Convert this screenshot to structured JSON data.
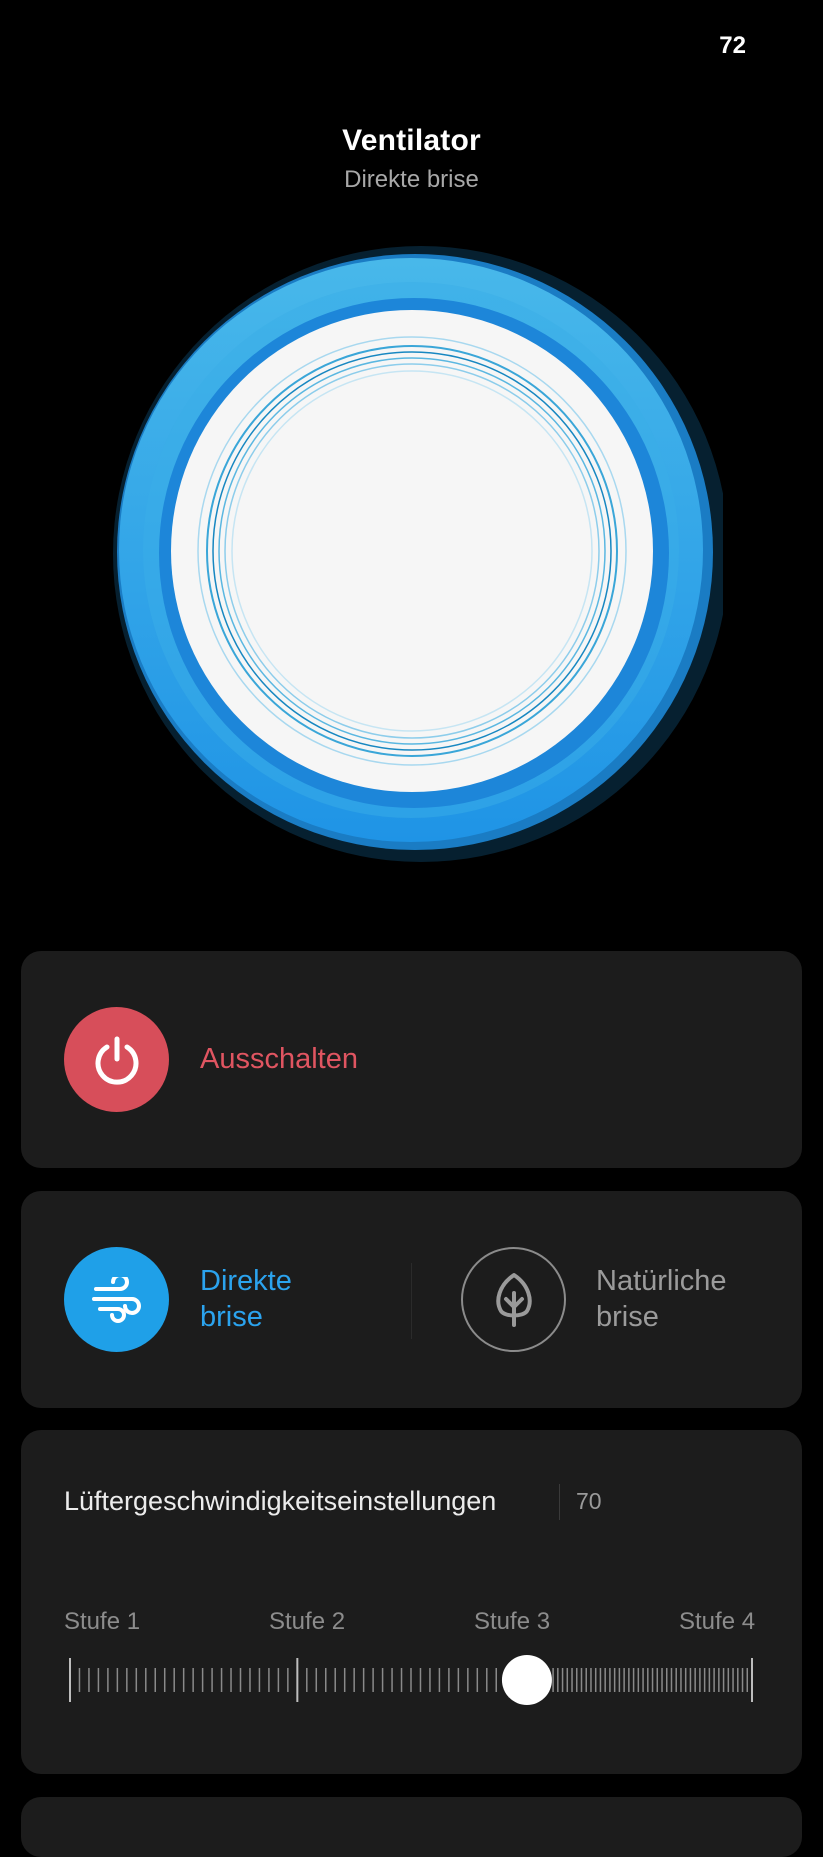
{
  "status_bar": {
    "number": "72"
  },
  "header": {
    "title": "Ventilator",
    "subtitle": "Direkte brise"
  },
  "colors": {
    "accent_blue": "#1fa0e8",
    "power_red": "#d74e5a",
    "card_bg": "#1c1c1c"
  },
  "power": {
    "label": "Ausschalten",
    "icon": "power-icon"
  },
  "modes": [
    {
      "label_line1": "Direkte",
      "label_line2": "brise",
      "icon": "wind-icon",
      "active": true
    },
    {
      "label_line1": "Natürliche",
      "label_line2": "brise",
      "icon": "leaf-icon",
      "active": false
    }
  ],
  "speed": {
    "title": "Lüftergeschwindigkeitseinstellungen",
    "value": "70",
    "steps": [
      "Stufe 1",
      "Stufe 2",
      "Stufe 3",
      "Stufe 4"
    ],
    "level": 0.67
  }
}
